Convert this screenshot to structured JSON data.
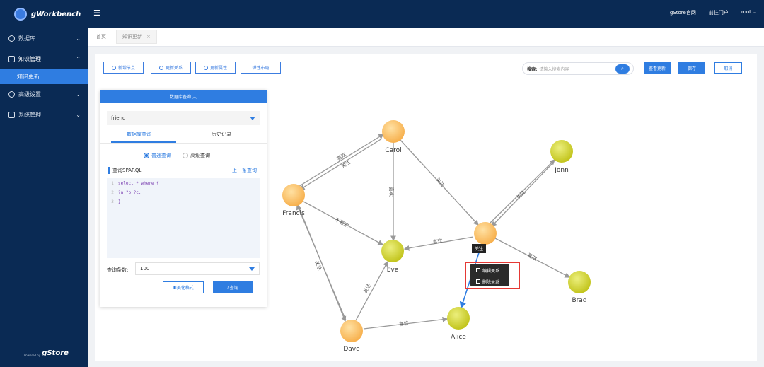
{
  "app": {
    "name": "gWorkbench",
    "powered_by": "Powered by",
    "powered_brand": "gStore"
  },
  "sidebar": {
    "items": [
      {
        "label": "数据库",
        "icon": "database-icon"
      },
      {
        "label": "知识管理",
        "icon": "knowledge-icon",
        "expanded": true
      },
      {
        "label": "高级设置",
        "icon": "settings-icon"
      },
      {
        "label": "系统管理",
        "icon": "system-icon"
      }
    ],
    "sub_active": "知识更新"
  },
  "topbar": {
    "links": [
      "gStore官网",
      "前往门户",
      "root"
    ]
  },
  "tabs": [
    {
      "label": "首页"
    },
    {
      "label": "知识更新",
      "active": true
    }
  ],
  "toolbar": {
    "add_node": "新增节点",
    "update_relation": "更新关系",
    "update_property": "更新属性",
    "elastic_layout": "弹性布局",
    "search_label": "搜索:",
    "search_placeholder": "请输入搜索内容",
    "view_updates": "查看更新",
    "save": "保存",
    "cancel": "取消"
  },
  "panel": {
    "header": "数据库查询 ︽",
    "db_value": "friend",
    "tabs": [
      "数据库查询",
      "历史记录"
    ],
    "modes": [
      "普通查询",
      "高级查询"
    ],
    "query_title": "查询SPARQL",
    "last_query_link": "上一条查询",
    "code_lines": [
      {
        "num": "1",
        "text": "select * where {"
      },
      {
        "num": "2",
        "text": "?a ?b ?c."
      },
      {
        "num": "3",
        "text": "}"
      }
    ],
    "count_label": "查询条数:",
    "count_value": "100",
    "beautify": "美化格式",
    "query": "查询"
  },
  "graph": {
    "node_labels": [
      "Carol",
      "Francis",
      "Jonn",
      "Eve",
      "Brad",
      "Alice",
      "Dave"
    ],
    "edge_labels": [
      "喜欢",
      "关注",
      "喜欢",
      "不喜欢",
      "关注",
      "喜欢",
      "关注",
      "喜欢",
      "关注",
      "关注",
      "喜欢"
    ],
    "tooltip": "关注",
    "context_menu": [
      "编辑关系",
      "删除关系"
    ],
    "colors": {
      "orange_node": "#fcc160",
      "green_node": "#d4d935",
      "edge": "#999999",
      "selected_edge": "#2f7de1",
      "highlight_box": "#e53935"
    }
  }
}
